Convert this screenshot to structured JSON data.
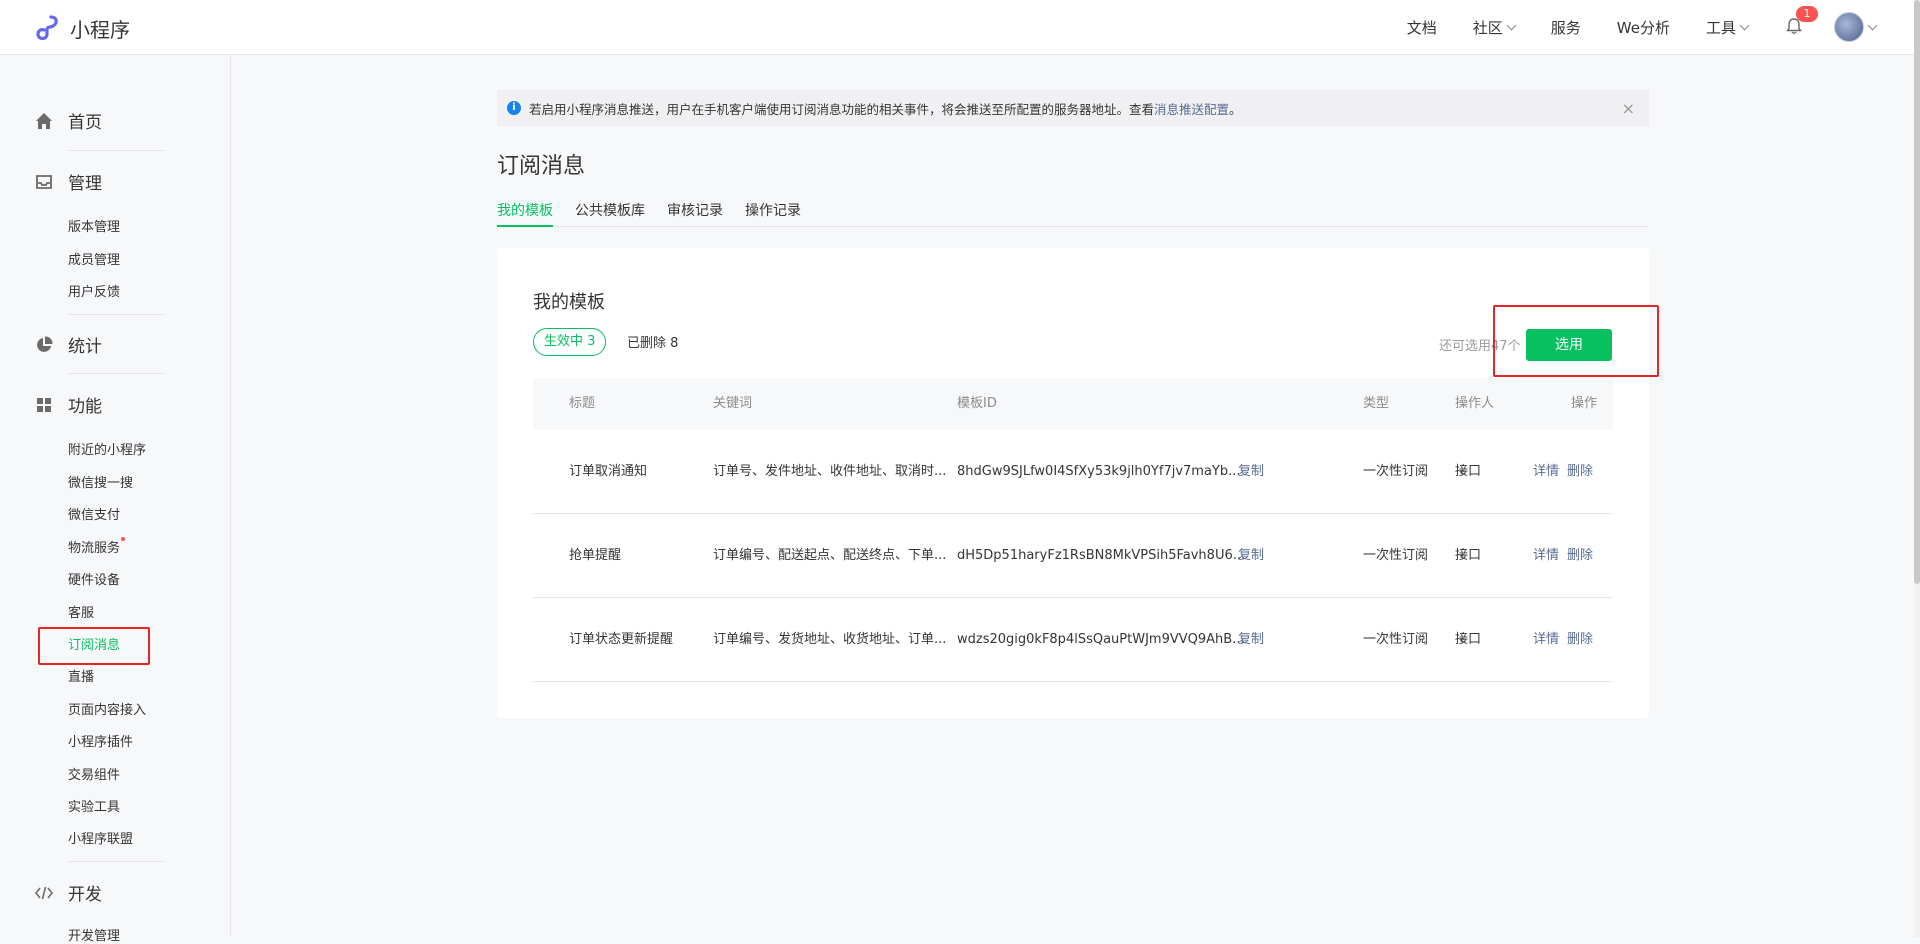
{
  "header": {
    "brand": "小程序",
    "nav": [
      {
        "label": "文档",
        "dropdown": false
      },
      {
        "label": "社区",
        "dropdown": true
      },
      {
        "label": "服务",
        "dropdown": false
      },
      {
        "label": "We分析",
        "dropdown": false
      },
      {
        "label": "工具",
        "dropdown": true
      }
    ],
    "notification_count": "1",
    "accent_color": "#07c160"
  },
  "sidebar": {
    "groups": [
      {
        "label": "首页",
        "icon": "home-icon"
      },
      {
        "label": "管理",
        "icon": "inbox-icon",
        "items": [
          "版本管理",
          "成员管理",
          "用户反馈"
        ]
      },
      {
        "label": "统计",
        "icon": "pie-chart-icon"
      },
      {
        "label": "功能",
        "icon": "grid-icon",
        "items": [
          "附近的小程序",
          "微信搜一搜",
          "微信支付",
          "物流服务",
          "硬件设备",
          "客服",
          "订阅消息",
          "直播",
          "页面内容接入",
          "小程序插件",
          "交易组件",
          "实验工具",
          "小程序联盟"
        ]
      },
      {
        "label": "开发",
        "icon": "code-icon",
        "items": [
          "开发管理"
        ]
      }
    ],
    "active_item": "订阅消息"
  },
  "notice": {
    "text": "若启用小程序消息推送，用户在手机客户端使用订阅消息功能的相关事件，将会推送至所配置的服务器地址。查看",
    "link": "消息推送配置",
    "suffix": "。",
    "close": "×"
  },
  "page": {
    "title": "订阅消息",
    "tabs": [
      "我的模板",
      "公共模板库",
      "审核记录",
      "操作记录"
    ],
    "active_tab": "我的模板"
  },
  "card": {
    "title": "我的模板",
    "active_filter": "生效中  3",
    "deleted_filter": "已删除  8",
    "remaining": "还可选用47个",
    "select_button": "选用",
    "columns": [
      "标题",
      "关键词",
      "模板ID",
      "类型",
      "操作人",
      "操作"
    ],
    "rows": [
      {
        "title": "订单取消通知",
        "keywords": "订单号、发件地址、收件地址、取消时...",
        "template_id": "8hdGw9SJLfw0I4SfXy53k9jlh0Yf7jv7maYb...",
        "copy": "复制",
        "type": "一次性订阅",
        "operator": "接口",
        "detail": "详情",
        "delete": "删除"
      },
      {
        "title": "抢单提醒",
        "keywords": "订单编号、配送起点、配送终点、下单...",
        "template_id": "dH5Dp51haryFz1RsBN8MkVPSih5Favh8U6...",
        "copy": "复制",
        "type": "一次性订阅",
        "operator": "接口",
        "detail": "详情",
        "delete": "删除"
      },
      {
        "title": "订单状态更新提醒",
        "keywords": "订单编号、发货地址、收货地址、订单...",
        "template_id": "wdzs20gig0kF8p4lSsQauPtWJm9VVQ9AhB...",
        "copy": "复制",
        "type": "一次性订阅",
        "operator": "接口",
        "detail": "详情",
        "delete": "删除"
      }
    ]
  }
}
